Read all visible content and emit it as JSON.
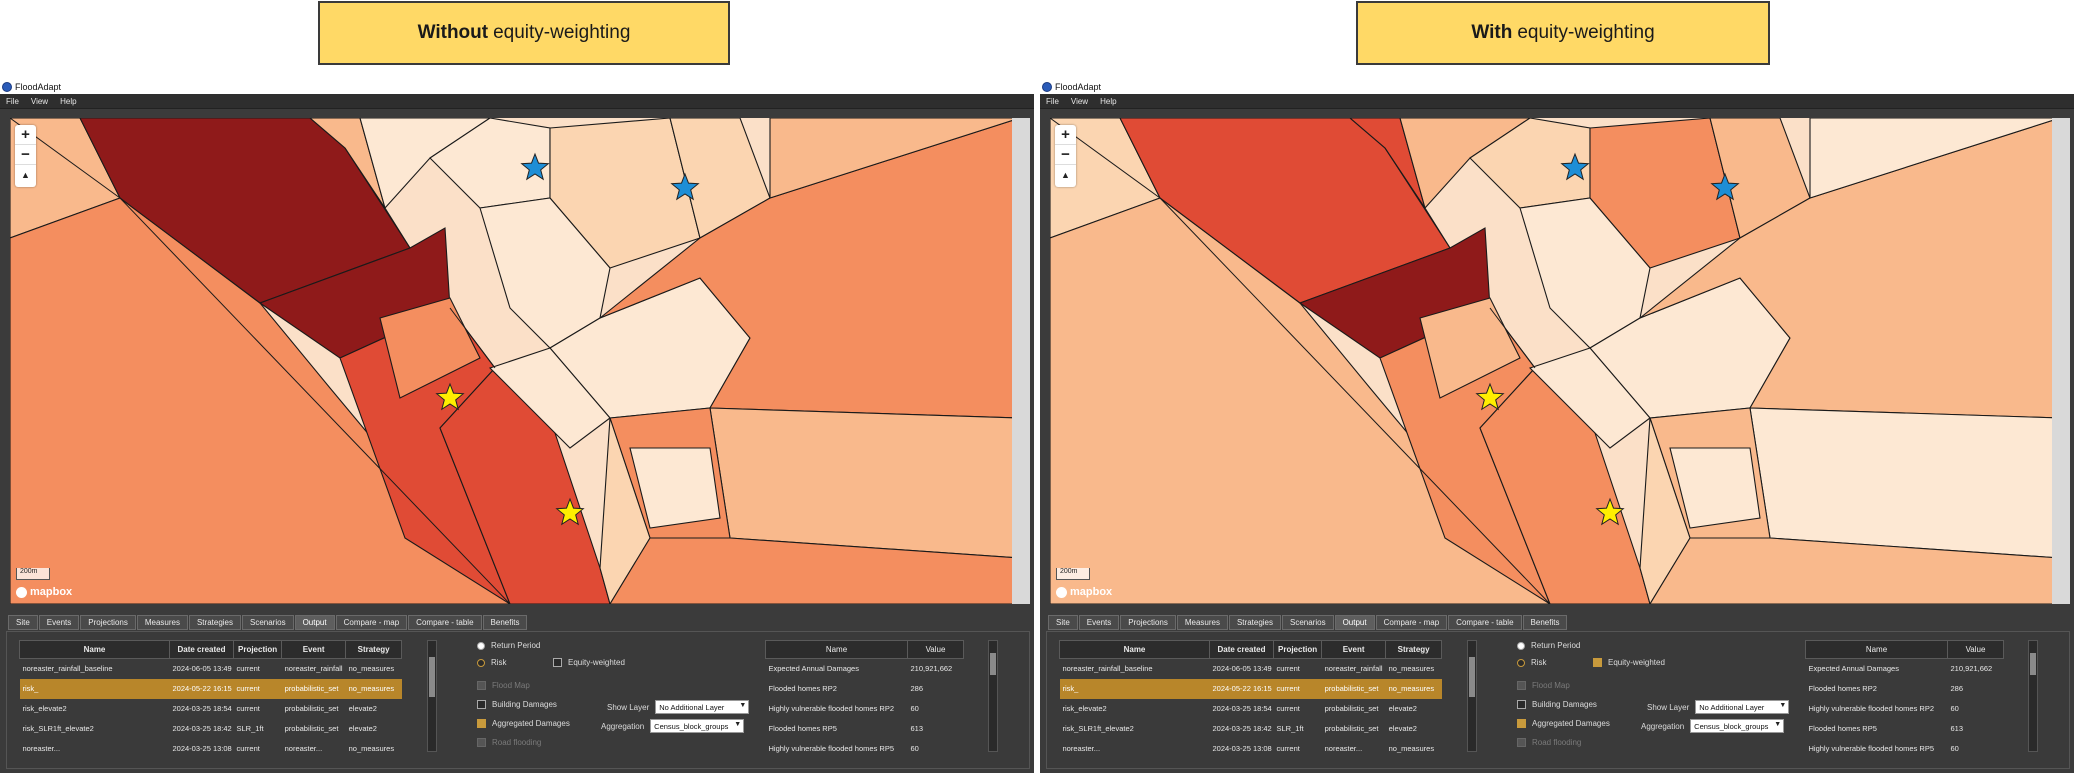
{
  "captions": {
    "left": {
      "bold": "Without",
      "rest": "equity-weighting"
    },
    "right": {
      "bold": "With",
      "rest": "equity-weighting"
    }
  },
  "app": {
    "title": "FloodAdapt",
    "menu": [
      "File",
      "View",
      "Help"
    ],
    "map": {
      "scale": "200m",
      "logo": "mapbox",
      "zoom_in": "+",
      "zoom_out": "−",
      "compass": "▲"
    },
    "tabs": [
      "Site",
      "Events",
      "Projections",
      "Measures",
      "Strategies",
      "Scenarios",
      "Output",
      "Compare - map",
      "Compare - table",
      "Benefits"
    ],
    "active_tab": "Output",
    "scenarios": {
      "headers": [
        "Name",
        "Date created",
        "Projection",
        "Event",
        "Strategy"
      ],
      "rows": [
        [
          "noreaster_rainfall_baseline",
          "2024-06-05 13:49",
          "current",
          "noreaster_rainfall",
          "no_measures"
        ],
        [
          "risk_",
          "2024-05-22 16:15",
          "current",
          "probabilistic_set",
          "no_measures"
        ],
        [
          "risk_elevate2",
          "2024-03-25 18:54",
          "current",
          "probabilistic_set",
          "elevate2"
        ],
        [
          "risk_SLR1ft_elevate2",
          "2024-03-25 18:42",
          "SLR_1ft",
          "probabilistic_set",
          "elevate2"
        ],
        [
          "noreaster...",
          "2024-03-25 13:08",
          "current",
          "noreaster...",
          "no_measures"
        ]
      ],
      "selected_row": 1
    },
    "options": {
      "return_period": "Return Period",
      "risk": "Risk",
      "equity_weighted": "Equity-weighted",
      "flood_map": "Flood Map",
      "building_damages": "Building Damages",
      "aggregated_damages": "Aggregated Damages",
      "road_flooding": "Road flooding",
      "show_layer_label": "Show Layer",
      "show_layer_value": "No Additional Layer",
      "aggregation_label": "Aggregation",
      "aggregation_value": "Census_block_groups"
    },
    "metrics": {
      "headers": [
        "Name",
        "Value"
      ],
      "rows": [
        [
          "Expected Annual Damages",
          "210,921,662"
        ],
        [
          "Flooded homes RP2",
          "286"
        ],
        [
          "Highly vulnerable flooded homes RP2",
          "60"
        ],
        [
          "Flooded homes RP5",
          "613"
        ],
        [
          "Highly vulnerable flooded homes RP5",
          "60"
        ]
      ]
    }
  },
  "colors": {
    "caption_bg": "#ffd966",
    "very_dark": "#8f1a1a",
    "dark": "#e04b35",
    "medium": "#f48e5f",
    "light": "#f9b98c",
    "lighter": "#fbd5b1",
    "lightest": "#fde8d3",
    "star_yellow": "#ffee00",
    "star_blue": "#1e8ed6",
    "selection": "#b8862a"
  },
  "maps": {
    "left": {
      "polygon_classes": [
        "light",
        "medium",
        "very_dark",
        "very_dark",
        "light",
        "dark",
        "dark",
        "medium",
        "lightest",
        "lightest",
        "lighter",
        "lightest",
        "lightest",
        "lighter",
        "medium",
        "light",
        "medium",
        "lighter",
        "lightest",
        "lightest",
        "medium",
        "light"
      ]
    },
    "right": {
      "polygon_classes": [
        "lighter",
        "light",
        "dark",
        "very_dark",
        "dark",
        "medium",
        "medium",
        "light",
        "light",
        "lighter",
        "medium",
        "lightest",
        "lightest",
        "light",
        "light",
        "lightest",
        "light",
        "lighter",
        "lightest",
        "lightest",
        "light",
        "lightest"
      ]
    }
  }
}
